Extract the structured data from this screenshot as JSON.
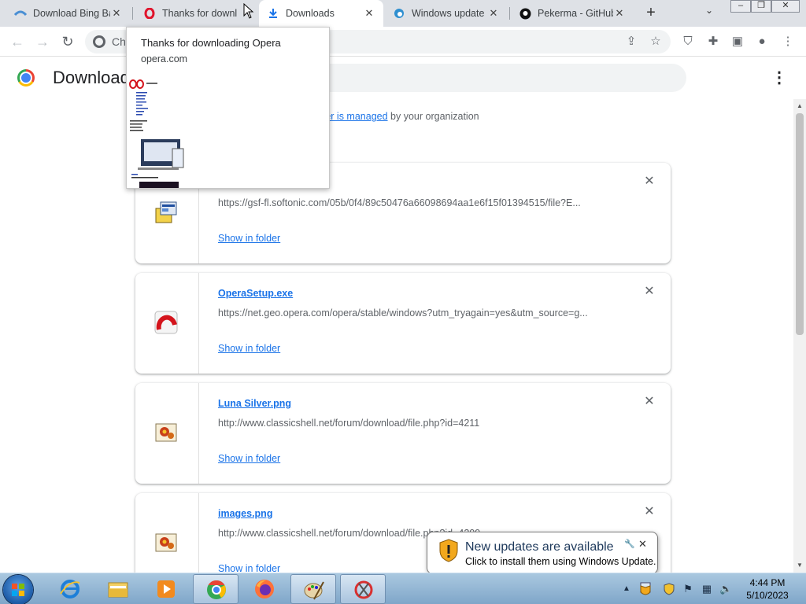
{
  "tabs": [
    {
      "label": "Download Bing Ba",
      "icon": "bing-icon"
    },
    {
      "label": "Thanks for downl",
      "icon": "opera-icon"
    },
    {
      "label": "Downloads",
      "icon": "download-icon"
    },
    {
      "label": "Windows update",
      "icon": "edge-icon"
    },
    {
      "label": "Pekerma - GitHub",
      "icon": "github-icon"
    }
  ],
  "omnibox": {
    "text": "Ch"
  },
  "page": {
    "title": "Downloads",
    "managed_link": "browser is managed",
    "managed_suffix": "by your organization"
  },
  "hover_card": {
    "title": "Thanks for downloading Opera",
    "site": "opera.com"
  },
  "downloads": [
    {
      "name": "",
      "url": "https://gsf-fl.softonic.com/05b/0f4/89c50476a66098694aa1e6f15f01394515/file?E...",
      "action": "Show in folder",
      "icon": "installer-icon"
    },
    {
      "name": "OperaSetup.exe",
      "url": "https://net.geo.opera.com/opera/stable/windows?utm_tryagain=yes&utm_source=g...",
      "action": "Show in folder",
      "icon": "opera-installer-icon"
    },
    {
      "name": "Luna Silver.png",
      "url": "http://www.classicshell.net/forum/download/file.php?id=4211",
      "action": "Show in folder",
      "icon": "image-file-icon"
    },
    {
      "name": "images.png",
      "url": "http://www.classicshell.net/forum/download/file.php?id=4209",
      "action": "Show in folder",
      "icon": "image-file-icon"
    }
  ],
  "toast": {
    "title": "New updates are available",
    "body": "Click to install them using Windows Update."
  },
  "clock": {
    "time": "4:44 PM",
    "date": "5/10/2023"
  },
  "colors": {
    "link": "#1a73e8",
    "tabstrip": "#dee1e6",
    "taskbar": "#8fb2d4"
  }
}
